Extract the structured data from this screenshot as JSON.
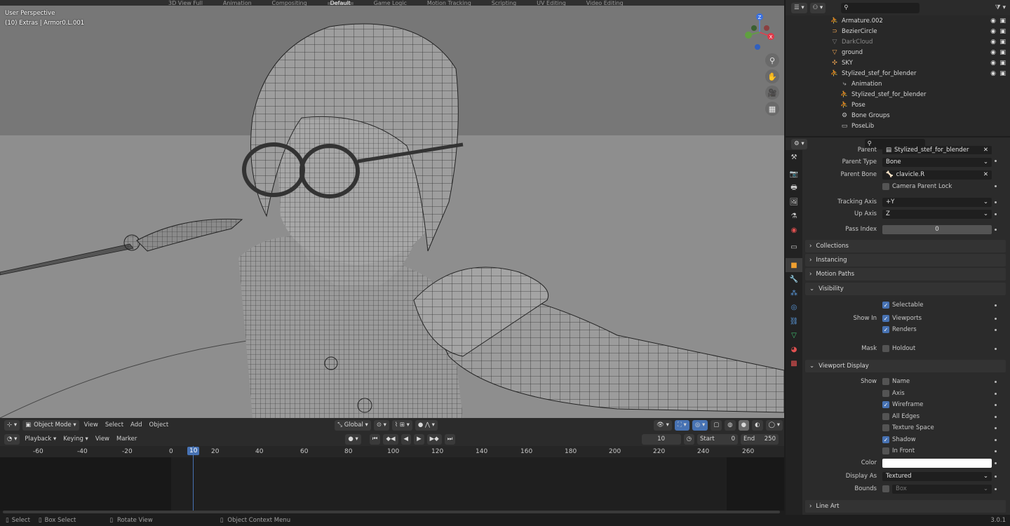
{
  "workspace_tabs": [
    "3D View Full",
    "Animation",
    "Compositing",
    "Default",
    "Game Logic",
    "Motion Tracking",
    "Scripting",
    "UV Editing",
    "Video Editing"
  ],
  "viewport": {
    "perspective_label": "User Perspective",
    "object_label": "(10) Extras | Armor0.L.001",
    "header": {
      "mode": "Object Mode",
      "menu": [
        "View",
        "Select",
        "Add",
        "Object"
      ],
      "transform_orientation": "Global"
    }
  },
  "timeline": {
    "header": {
      "menus": [
        "Playback",
        "Keying",
        "View",
        "Marker"
      ],
      "current_frame": "10",
      "start_label": "Start",
      "start": "0",
      "end_label": "End",
      "end": "250"
    },
    "ruler": [
      "-60",
      "-40",
      "-20",
      "0",
      "10",
      "20",
      "40",
      "60",
      "80",
      "100",
      "120",
      "140",
      "160",
      "180",
      "200",
      "220",
      "240",
      "260"
    ]
  },
  "statusbar": {
    "select": "Select",
    "box_select": "Box Select",
    "rotate_view": "Rotate View",
    "context_menu": "Object Context Menu",
    "version": "3.0.1"
  },
  "outliner": {
    "items": [
      {
        "name": "Armature.002",
        "indent": 1,
        "icon": "armature-icon",
        "color": "#e8a050"
      },
      {
        "name": "BezierCircle",
        "indent": 1,
        "icon": "curve-icon",
        "color": "#e8a050"
      },
      {
        "name": "DarkCloud",
        "indent": 1,
        "icon": "mesh-icon",
        "color": "#7a7a7a"
      },
      {
        "name": "ground",
        "indent": 1,
        "icon": "mesh-icon",
        "color": "#e8a050"
      },
      {
        "name": "SKY",
        "indent": 1,
        "icon": "empty-icon",
        "color": "#e8a050"
      },
      {
        "name": "Stylized_stef_for_blender",
        "indent": 1,
        "icon": "armature-icon",
        "color": "#e8a050"
      },
      {
        "name": "Animation",
        "indent": 2,
        "icon": "action-icon",
        "color": "#c8c8c8"
      },
      {
        "name": "Stylized_stef_for_blender",
        "indent": 2,
        "icon": "armature-data-icon",
        "color": "#60c0a0"
      },
      {
        "name": "Pose",
        "indent": 2,
        "icon": "pose-icon",
        "color": "#60c0a0"
      },
      {
        "name": "Bone Groups",
        "indent": 2,
        "icon": "bone-group-icon",
        "color": "#c8c8c8"
      },
      {
        "name": "PoseLib",
        "indent": 2,
        "icon": "poselib-icon",
        "color": "#c8c8c8"
      }
    ]
  },
  "properties": {
    "parent_label": "Parent",
    "parent_value": "Stylized_stef_for_blender",
    "parent_type_label": "Parent Type",
    "parent_type": "Bone",
    "parent_bone_label": "Parent Bone",
    "parent_bone": "clavicle.R",
    "camera_parent_lock": "Camera Parent Lock",
    "tracking_axis_label": "Tracking Axis",
    "tracking_axis": "+Y",
    "up_axis_label": "Up Axis",
    "up_axis": "Z",
    "pass_index_label": "Pass Index",
    "pass_index": "0",
    "sections": {
      "collections": "Collections",
      "instancing": "Instancing",
      "motion_paths": "Motion Paths",
      "visibility": "Visibility",
      "viewport_display": "Viewport Display",
      "line_art": "Line Art"
    },
    "visibility": {
      "selectable": "Selectable",
      "show_in": "Show In",
      "viewports": "Viewports",
      "renders": "Renders",
      "mask": "Mask",
      "holdout": "Holdout"
    },
    "viewport_display": {
      "show": "Show",
      "name": "Name",
      "axis": "Axis",
      "wireframe": "Wireframe",
      "all_edges": "All Edges",
      "texture_space": "Texture Space",
      "shadow": "Shadow",
      "in_front": "In Front",
      "color": "Color",
      "display_as_label": "Display As",
      "display_as": "Textured",
      "bounds": "Bounds",
      "bounds_type": "Box"
    }
  }
}
